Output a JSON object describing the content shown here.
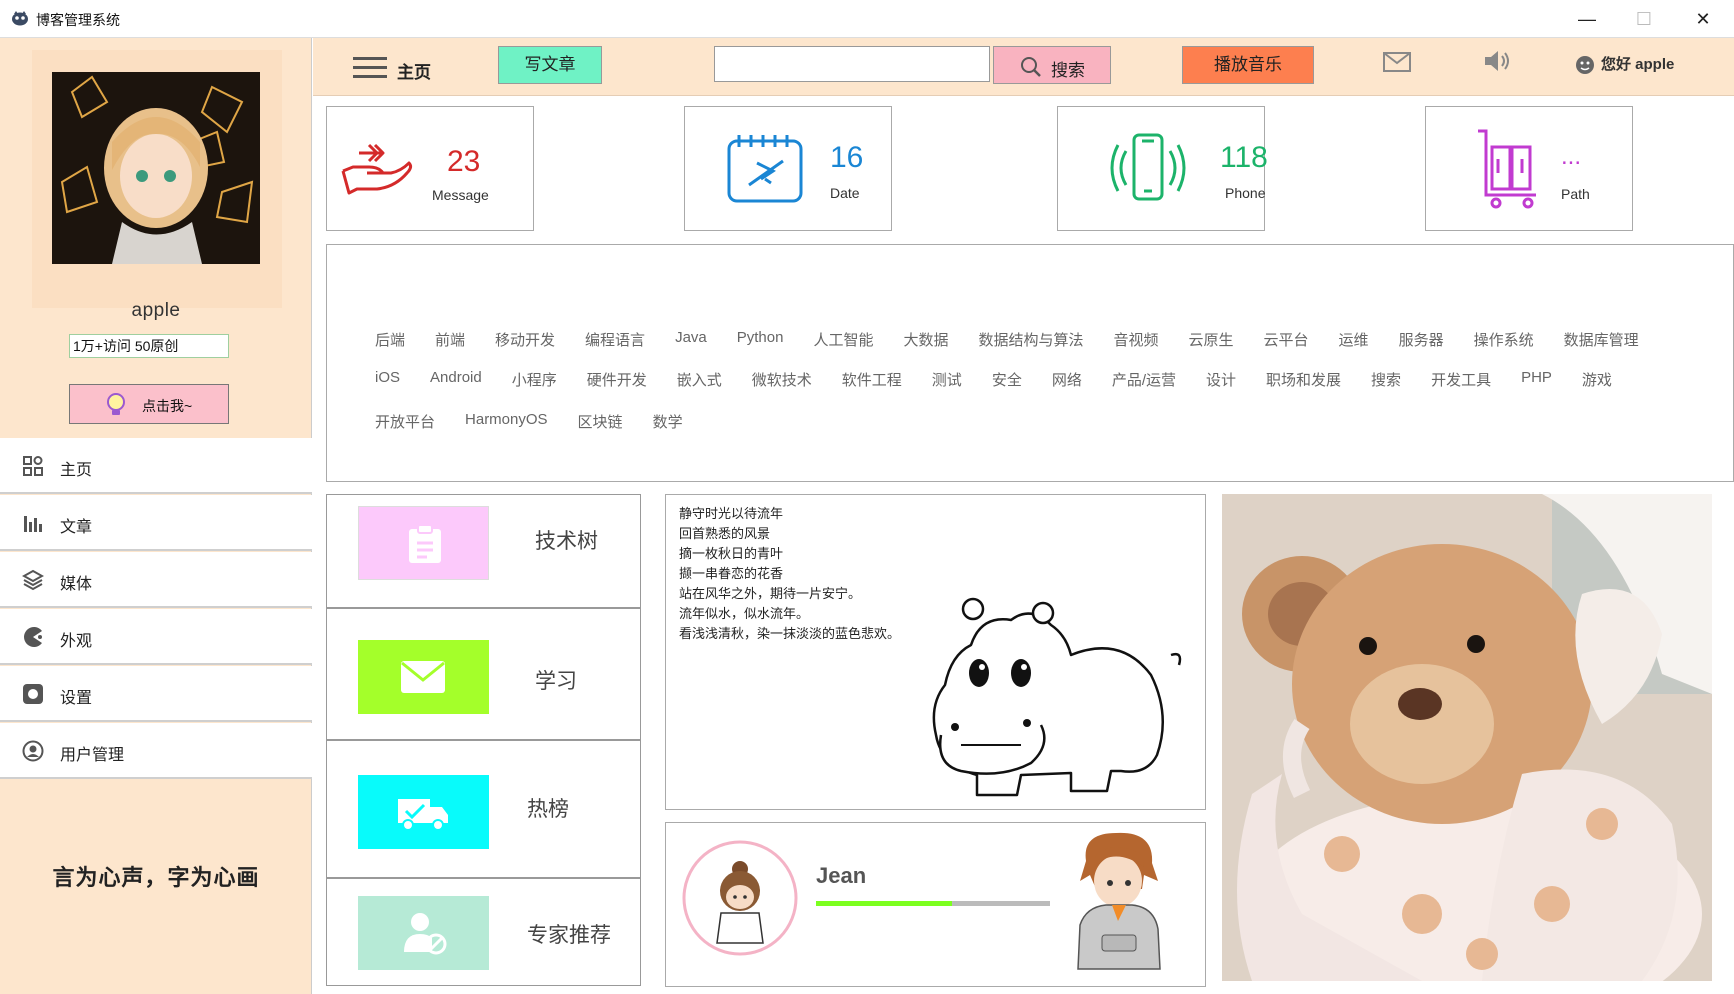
{
  "window": {
    "title": "博客管理系统",
    "controls": [
      "—",
      "☐",
      "✕"
    ]
  },
  "sidebar": {
    "username": "apple",
    "stats": "1万+访问 50原创",
    "click_label": "点击我~",
    "nav": [
      {
        "label": "主页",
        "icon": "grid-icon"
      },
      {
        "label": "文章",
        "icon": "bar-chart-icon"
      },
      {
        "label": "媒体",
        "icon": "layers-icon"
      },
      {
        "label": "外观",
        "icon": "pacman-icon"
      },
      {
        "label": "设置",
        "icon": "gear-icon"
      },
      {
        "label": "用户管理",
        "icon": "user-circle-icon"
      }
    ],
    "motto": "言为心声，字为心画"
  },
  "topbar": {
    "home_label": "主页",
    "write_label": "写文章",
    "search_value": "",
    "search_label": "搜索",
    "music_label": "播放音乐",
    "greeting": "您好 apple"
  },
  "cards": [
    {
      "value": "23",
      "label": "Message",
      "color": "#d42a2a",
      "icon": "hand-icon"
    },
    {
      "value": "16",
      "label": "Date",
      "color": "#1a86d4",
      "icon": "calendar-plane-icon"
    },
    {
      "value": "118",
      "label": "Phone",
      "color": "#1cb36a",
      "icon": "phone-vibrate-icon"
    },
    {
      "value": "...",
      "label": "Path",
      "color": "#c13bd0",
      "icon": "luggage-cart-icon"
    }
  ],
  "tags": {
    "row1": [
      "后端",
      "前端",
      "移动开发",
      "编程语言",
      "Java",
      "Python",
      "人工智能",
      "大数据",
      "数据结构与算法",
      "音视频",
      "云原生",
      "云平台",
      "运维",
      "服务器",
      "操作系统",
      "数据库管理"
    ],
    "row2": [
      "iOS",
      "Android",
      "小程序",
      "硬件开发",
      "嵌入式",
      "微软技术",
      "软件工程",
      "测试",
      "安全",
      "网络",
      "产品/运营",
      "设计",
      "职场和发展",
      "搜索",
      "开发工具",
      "PHP",
      "游戏"
    ],
    "row3": [
      "开放平台",
      "HarmonyOS",
      "区块链",
      "数学"
    ]
  },
  "features": [
    {
      "label": "技术树",
      "color": "#fcc9fb",
      "icon": "clipboard-icon"
    },
    {
      "label": "学习",
      "color": "#a4ff2a",
      "icon": "envelope-icon"
    },
    {
      "label": "热榜",
      "color": "#08fbfb",
      "icon": "truck-check-icon"
    },
    {
      "label": "专家推荐",
      "color": "#b6ead6",
      "icon": "user-block-icon"
    }
  ],
  "poem": [
    "静守时光以待流年",
    "回首熟悉的风景",
    "摘一枚秋日的青叶",
    "撷一串眷恋的花香",
    "站在风华之外，期待一片安宁。",
    "流年似水，似水流年。",
    "看浅浅清秋，染一抹淡淡的蓝色悲欢。"
  ],
  "profile": {
    "name": "Jean",
    "progress": 0.58
  }
}
